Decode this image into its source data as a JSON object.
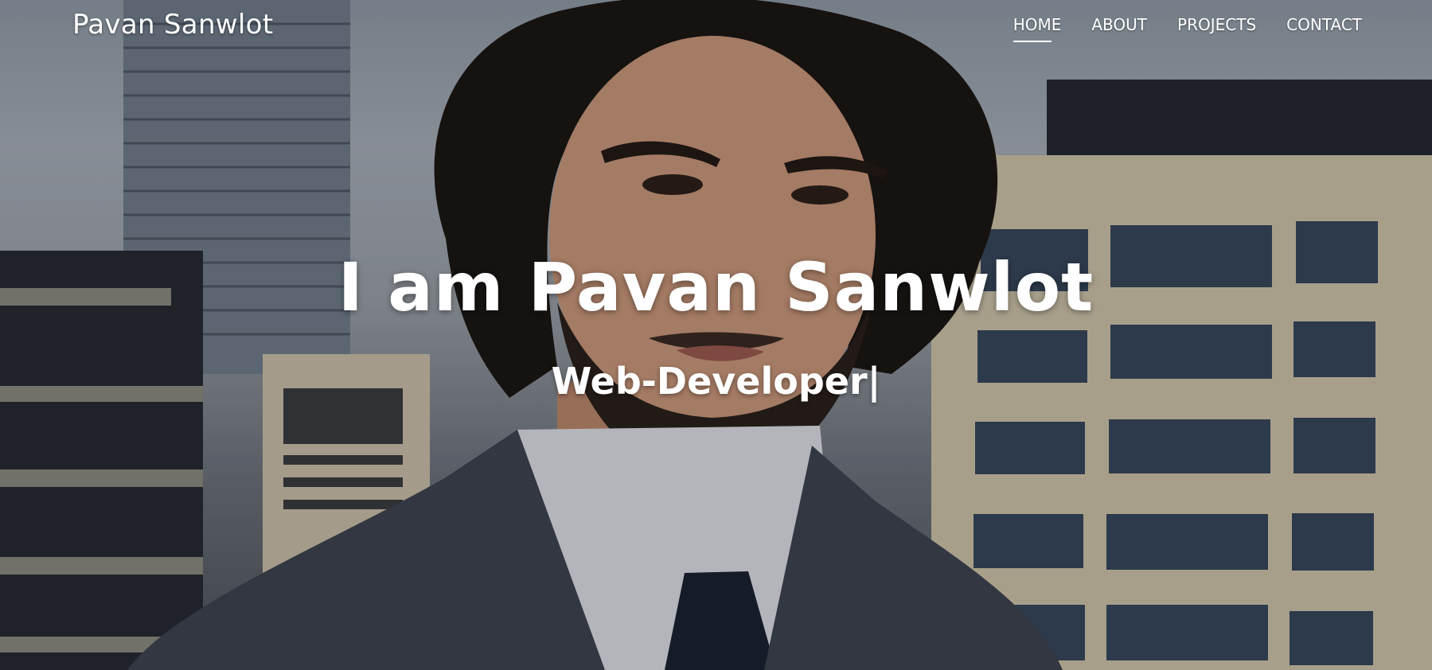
{
  "navbar": {
    "brand": "Pavan Sanwlot",
    "links": [
      {
        "label": "HOME",
        "active": true
      },
      {
        "label": "ABOUT",
        "active": false
      },
      {
        "label": "PROJECTS",
        "active": false
      },
      {
        "label": "CONTACT",
        "active": false
      }
    ]
  },
  "hero": {
    "headline": "I am Pavan Sanwlot",
    "typed_text": "Web-Developer|",
    "background_image": "portrait-in-city"
  },
  "colors": {
    "text": "#ffffff",
    "suit": "#3f4450",
    "tie": "#1c2133",
    "hair": "#1a1614",
    "skin": "#c9967a"
  }
}
